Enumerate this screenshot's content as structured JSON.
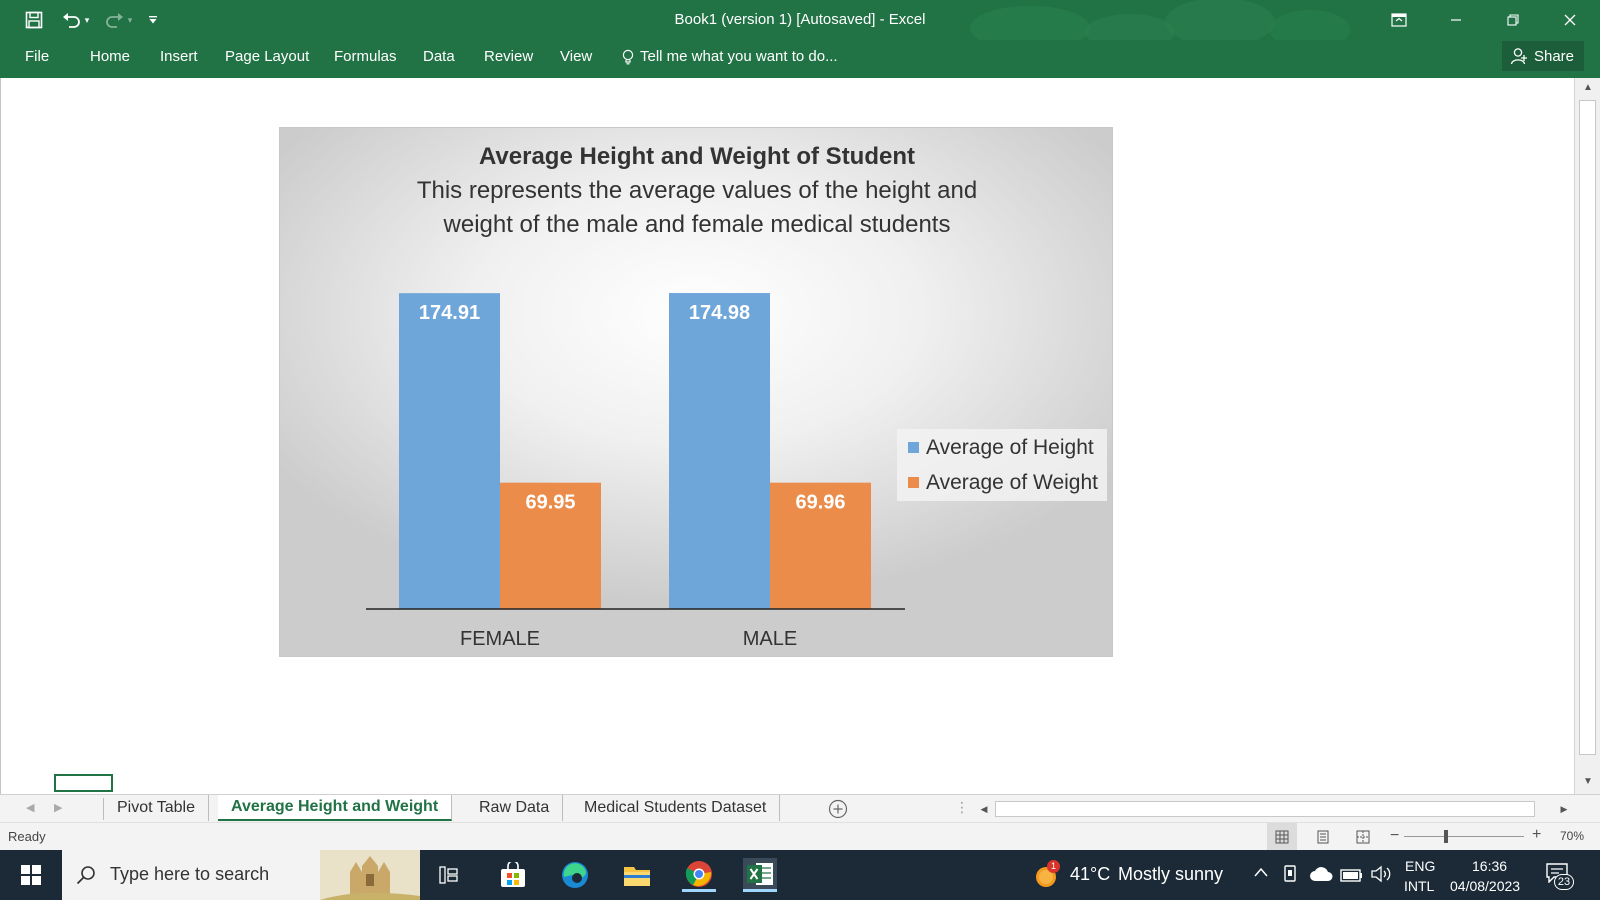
{
  "window": {
    "title": "Book1 (version 1) [Autosaved] - Excel"
  },
  "ribbon": {
    "tabs": [
      "File",
      "Home",
      "Insert",
      "Page Layout",
      "Formulas",
      "Data",
      "Review",
      "View"
    ],
    "tell_me": "Tell me what you want to do...",
    "share_label": "Share"
  },
  "chart_data": {
    "type": "bar",
    "title": "Average Height and Weight of Student",
    "subtitle_lines": [
      "This represents the average values of the height and",
      "weight of the male and female medical students"
    ],
    "categories": [
      "FEMALE",
      "MALE"
    ],
    "series": [
      {
        "name": "Average of Height",
        "values": [
          174.91,
          174.98
        ],
        "color": "#6fa6d9"
      },
      {
        "name": "Average of Weight",
        "values": [
          69.95,
          69.96
        ],
        "color": "#eb8c4b"
      }
    ],
    "data_labels": [
      [
        "174.91",
        "174.98"
      ],
      [
        "69.95",
        "69.96"
      ]
    ],
    "ylim": [
      0,
      175
    ],
    "grid": false,
    "legend": "right"
  },
  "sheet_tabs": {
    "tabs": [
      "Pivot Table",
      "Average Height and Weight",
      "Raw Data",
      "Medical Students Dataset"
    ],
    "active": "Average Height and Weight"
  },
  "status": {
    "mode": "Ready",
    "zoom": "70%"
  },
  "taskbar": {
    "search_placeholder": "Type here to search",
    "weather_badge": "1",
    "weather_temp": "41°C",
    "weather_desc": "Mostly sunny",
    "lang_1": "ENG",
    "lang_2": "INTL",
    "time": "16:36",
    "date": "04/08/2023",
    "notifications": "23"
  }
}
